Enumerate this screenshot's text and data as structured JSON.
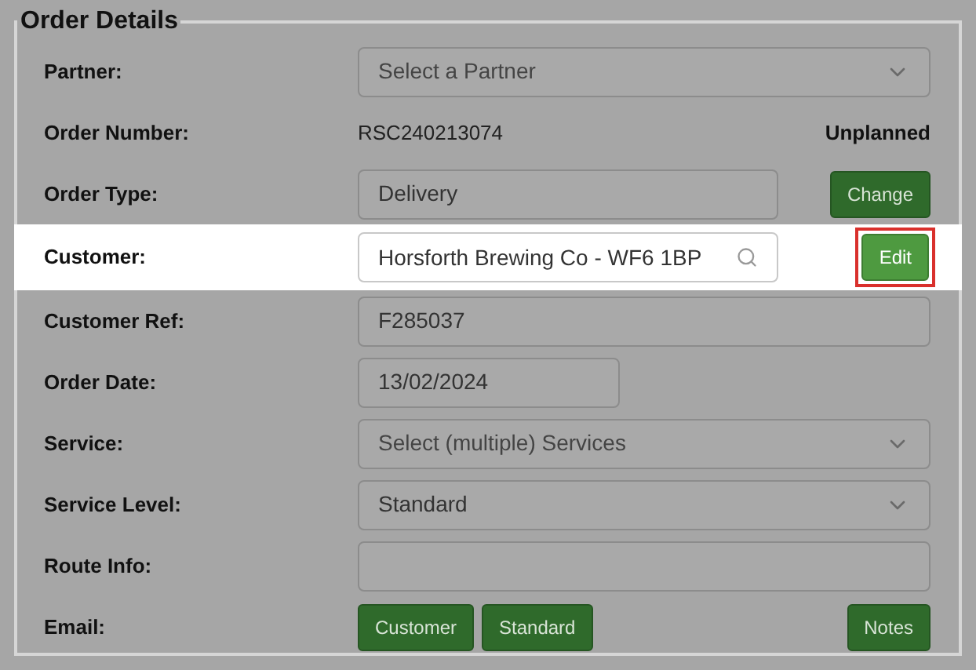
{
  "section": {
    "title": "Order Details"
  },
  "rows": [
    {
      "label": "Partner:",
      "kind": "select",
      "placeholder": "Select a Partner",
      "highlighted": false
    },
    {
      "label": "Order Number:",
      "kind": "static",
      "value": "RSC240213074",
      "status": "Unplanned",
      "highlighted": false
    },
    {
      "label": "Order Type:",
      "kind": "disabled",
      "value": "Delivery",
      "button": "Change",
      "highlighted": false
    },
    {
      "label": "Customer:",
      "kind": "search",
      "value": "Horsforth Brewing Co - WF6 1BP",
      "button": "Edit",
      "highlighted": true
    },
    {
      "label": "Customer Ref:",
      "kind": "input",
      "value": "F285037",
      "highlighted": false
    },
    {
      "label": "Order Date:",
      "kind": "date",
      "value": "13/02/2024",
      "highlighted": false
    },
    {
      "label": "Service:",
      "kind": "select",
      "placeholder": "Select (multiple) Services",
      "highlighted": false
    },
    {
      "label": "Service Level:",
      "kind": "select",
      "value": "Standard",
      "highlighted": false
    },
    {
      "label": "Route Info:",
      "kind": "input",
      "value": "",
      "highlighted": false
    },
    {
      "label": "Email:",
      "kind": "buttons",
      "buttons": [
        "Customer",
        "Standard"
      ],
      "button": "Notes",
      "highlighted": false
    }
  ]
}
